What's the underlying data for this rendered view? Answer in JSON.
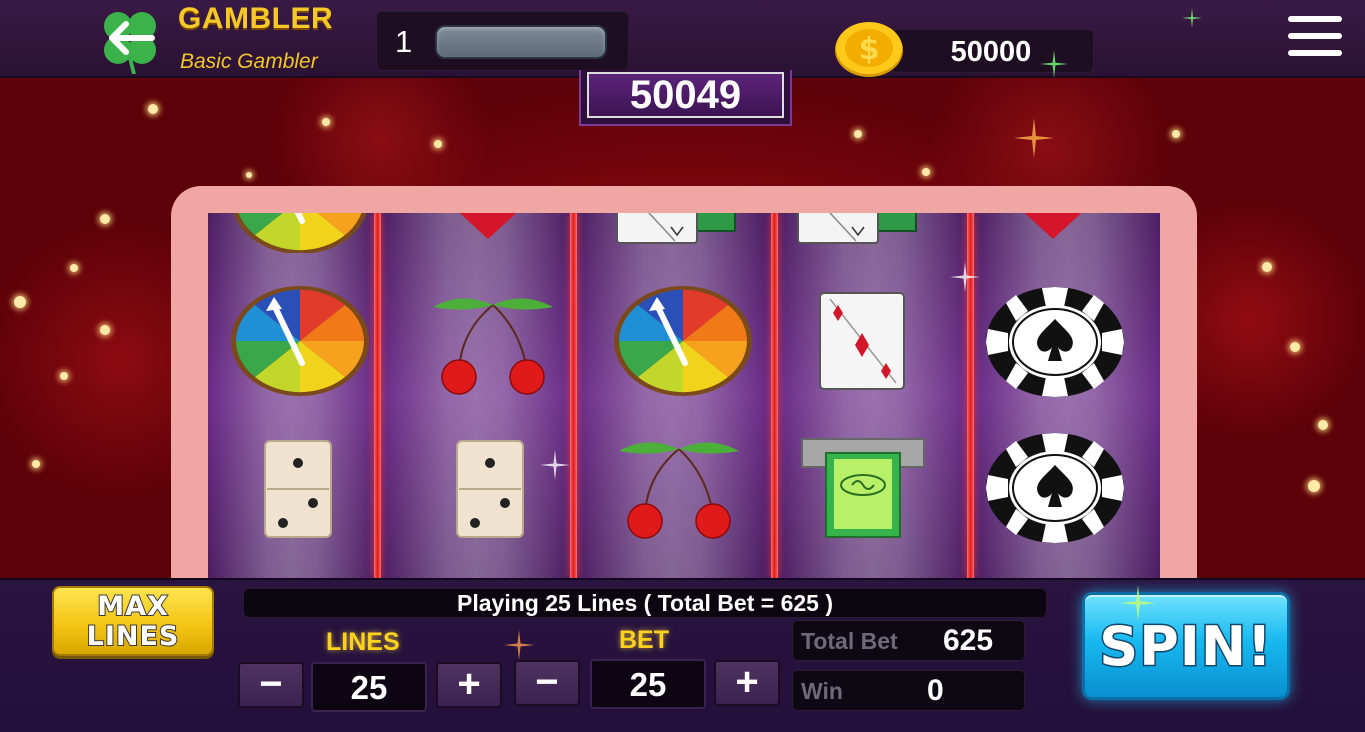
{
  "header": {
    "brand_title": "GAMBLER",
    "brand_subtitle": "Basic Gambler",
    "level": "1",
    "coins": "50000"
  },
  "jackpot": "50049",
  "reels": [
    [
      "wheel",
      "wheel",
      "domino"
    ],
    [
      "heart",
      "cherries",
      "domino"
    ],
    [
      "card",
      "wheel",
      "cherries"
    ],
    [
      "card",
      "card",
      "cash"
    ],
    [
      "heart",
      "chip",
      "chip"
    ]
  ],
  "controls": {
    "max_lines_top": "MAX",
    "max_lines_bottom": "LINES",
    "status": "Playing 25 Lines ( Total Bet = 625 )",
    "lines_label": "LINES",
    "lines_value": "25",
    "bet_label": "BET",
    "bet_value": "25",
    "minus": "−",
    "plus": "+",
    "total_bet_label": "Total Bet",
    "total_bet_value": "625",
    "win_label": "Win",
    "win_value": "0",
    "spin_label": "SPIN!"
  },
  "colors": {
    "brand_gold": "#f7c928",
    "spin_blue": "#17b9f0",
    "reel_separator": "#e01b1b",
    "frame_pink": "#f0a7a3"
  }
}
